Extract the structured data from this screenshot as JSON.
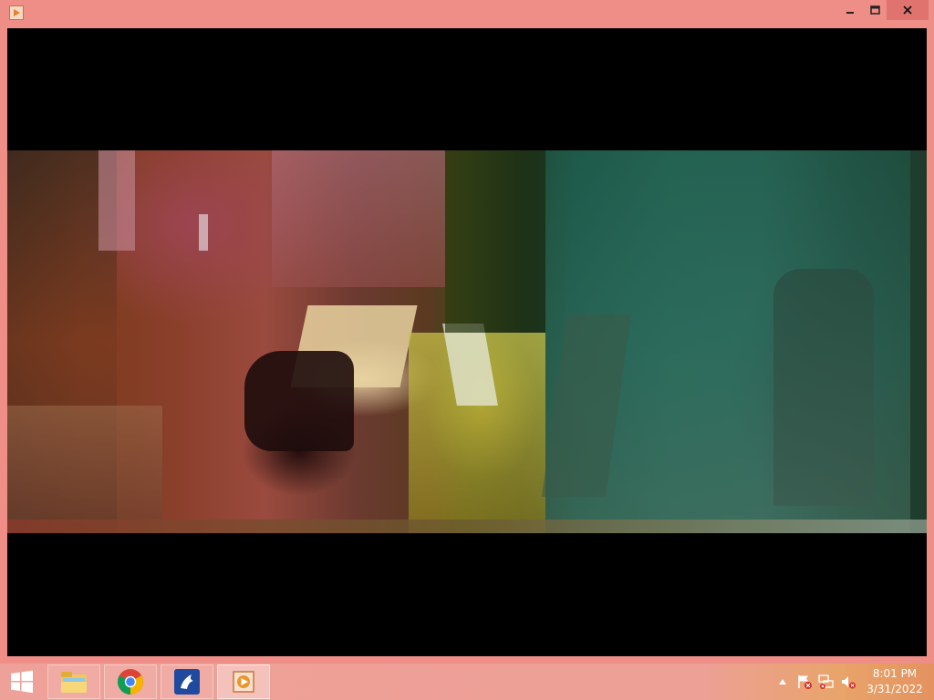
{
  "window": {
    "app_icon": "media-player-icon",
    "controls": {
      "minimize": "minimize-icon",
      "maximize": "maximize-icon",
      "close": "close-icon"
    }
  },
  "video": {
    "state": "playing, frame shows heavy compression artifacts"
  },
  "taskbar": {
    "start": "windows-logo-icon",
    "pinned": [
      {
        "name": "File Explorer",
        "icon": "folder-icon"
      },
      {
        "name": "Google Chrome",
        "icon": "chrome-icon"
      },
      {
        "name": "App",
        "icon": "app-icon"
      },
      {
        "name": "Media Player",
        "icon": "media-player-icon",
        "active": true
      }
    ],
    "tray": {
      "icons": [
        "show-hidden-icons-icon",
        "action-center-flag-icon",
        "network-icon",
        "volume-muted-icon"
      ],
      "time": "8:01 PM",
      "date": "3/31/2022"
    }
  },
  "colors": {
    "window_frame": "#ee8e86",
    "close_button": "#e0736d",
    "taskbar": "#eea198"
  }
}
